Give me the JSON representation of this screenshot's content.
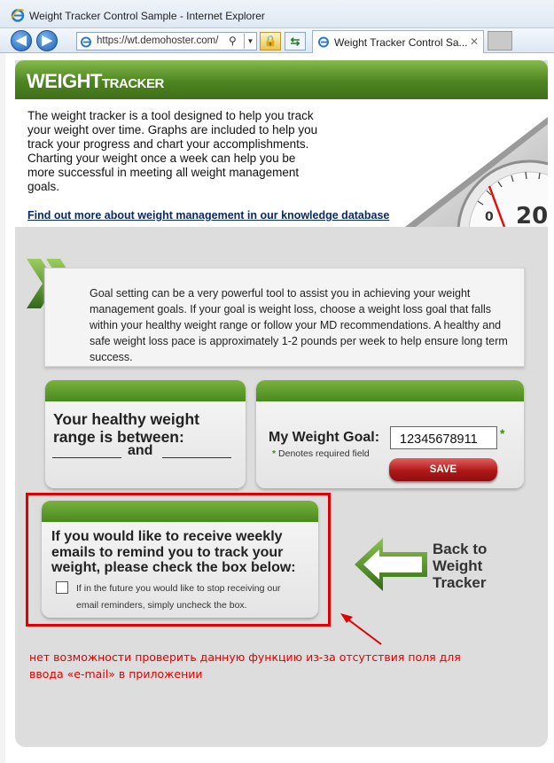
{
  "window": {
    "title": "Weight Tracker Control Sample - Internet Explorer"
  },
  "navbar": {
    "url": "https://wt.demohoster.com/",
    "tab_title": "Weight Tracker Control Sa...",
    "tab_close": "✕",
    "back_label": "◀",
    "forward_label": "▶"
  },
  "header": {
    "logo_main": "WEIGHT",
    "logo_sub": "TRACKER"
  },
  "intro": {
    "text": "The weight tracker is a tool designed to help you track your weight over time. Graphs are included to help you track your progress and chart your accomplishments. Charting your weight once a week can help you be more successful in meeting all weight management goals.",
    "link": "Find out more about weight management in our knowledge database"
  },
  "goal_setting": {
    "text": "Goal setting can be a very powerful tool to assist you in achieving your weight management goals.  If your goal is weight loss, choose a weight loss goal that falls within your healthy weight range or follow your MD recommendations.  A healthy and safe weight loss pace is approximately 1-2 pounds per week to help ensure long term success."
  },
  "healthy_range": {
    "heading": "Your healthy weight range is between:",
    "and_label": "and"
  },
  "weight_goal": {
    "label": "My Weight Goal:",
    "value": "12345678911",
    "required_star": "*",
    "required_note_star": "*",
    "required_note": "Denotes required field",
    "save_label": "SAVE"
  },
  "email_reminder": {
    "heading": "If you would like to receive weekly emails to remind you to track your weight, please check the box below:",
    "checked": false,
    "note": "If in the future you would like to stop receiving our email reminders, simply uncheck the box."
  },
  "back_link": {
    "label": "Back to Weight Tracker"
  },
  "annotation": {
    "text": "нет возможности проверить данную функцию из-за отсутствия поля для ввода «e-mail» в приложении",
    "color": "#e00000"
  },
  "colors": {
    "brand_green": "#4e8521",
    "save_red": "#b11818",
    "annotation_red": "#e00000"
  }
}
